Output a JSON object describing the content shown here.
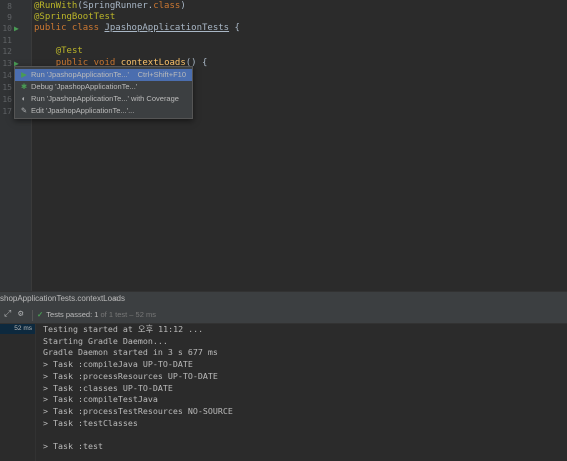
{
  "editor": {
    "line_numbers": [
      "8",
      "9",
      "10",
      "11",
      "12",
      "13",
      "14",
      "15",
      "16",
      "17"
    ],
    "lines": [
      {
        "parts": [
          {
            "t": "@RunWith",
            "c": "ann"
          },
          {
            "t": "(SpringRunner.",
            "c": ""
          },
          {
            "t": "class",
            "c": "kw"
          },
          {
            "t": ")",
            "c": ""
          }
        ]
      },
      {
        "parts": [
          {
            "t": "@SpringBootTest",
            "c": "ann"
          }
        ]
      },
      {
        "parts": [
          {
            "t": "public class ",
            "c": "kw"
          },
          {
            "t": "JpashopApplicationTests",
            "c": "cls-hl"
          },
          {
            "t": " {",
            "c": ""
          }
        ]
      },
      {
        "parts": []
      },
      {
        "parts": [
          {
            "t": "    ",
            "c": ""
          },
          {
            "t": "@Test",
            "c": "ann"
          }
        ]
      },
      {
        "parts": [
          {
            "t": "    ",
            "c": ""
          },
          {
            "t": "public void ",
            "c": "kw"
          },
          {
            "t": "contextLoads",
            "c": "fn"
          },
          {
            "t": "() {",
            "c": ""
          }
        ]
      }
    ],
    "gutter_icons": [
      "run-test-icon",
      "run-test-icon"
    ]
  },
  "popup": {
    "items": [
      {
        "icon": "▶",
        "icon_color": "#499c54",
        "label": "Run 'JpashopApplicationTe...'",
        "shortcut": "Ctrl+Shift+F10",
        "selected": true
      },
      {
        "icon": "✱",
        "icon_color": "#499c54",
        "label": "Debug 'JpashopApplicationTe...'",
        "shortcut": "",
        "selected": false
      },
      {
        "icon": "◐",
        "icon_color": "#afb1b3",
        "label": "Run 'JpashopApplicationTe...' with Coverage",
        "shortcut": "",
        "selected": false
      },
      {
        "icon": "✎",
        "icon_color": "#afb1b3",
        "label": "Edit 'JpashopApplicationTe...'...",
        "shortcut": "",
        "selected": false
      }
    ]
  },
  "run_panel": {
    "tab_title": "shopApplicationTests.contextLoads",
    "close": "×",
    "status_label": "Tests passed:",
    "status_count": "1",
    "status_detail": "of 1 test – 52 ms",
    "tree_duration": "52 ms",
    "console": [
      "Testing started at 오후 11:12 ...",
      "Starting Gradle Daemon...",
      "Gradle Daemon started in 3 s 677 ms",
      "> Task :compileJava UP-TO-DATE",
      "> Task :processResources UP-TO-DATE",
      "> Task :classes UP-TO-DATE",
      "> Task :compileTestJava",
      "> Task :processTestResources NO-SOURCE",
      "> Task :testClasses",
      "",
      "> Task :test"
    ]
  },
  "colors": {
    "accent": "#4b6eaf",
    "pass": "#499c54"
  }
}
